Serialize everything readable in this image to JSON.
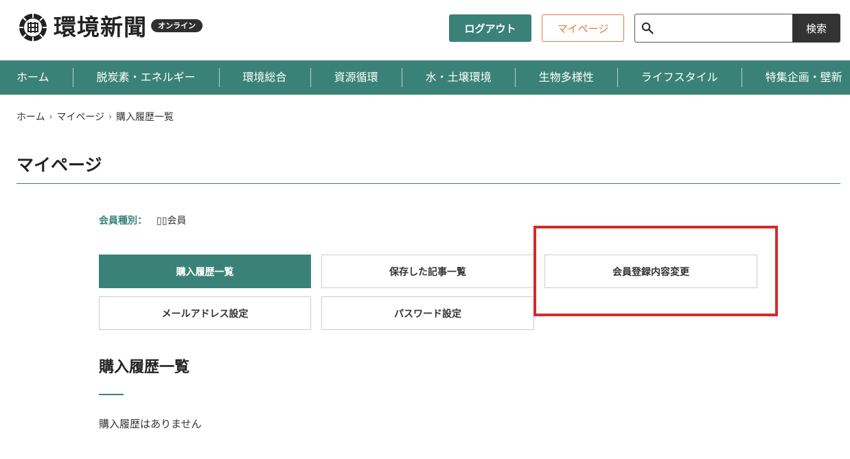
{
  "header": {
    "logo_text": "環境新聞",
    "logo_badge": "オンライン",
    "logout_label": "ログアウト",
    "mypage_label": "マイページ",
    "search": {
      "placeholder": "",
      "value": "",
      "button_label": "検索"
    }
  },
  "nav": {
    "items": [
      "ホーム",
      "脱炭素・エネルギー",
      "環境総合",
      "資源循環",
      "水・土壌環境",
      "生物多様性",
      "ライフスタイル",
      "特集企画・壁新"
    ]
  },
  "breadcrumb": {
    "items": [
      "ホーム",
      "マイページ",
      "購入履歴一覧"
    ],
    "separator": "›"
  },
  "page": {
    "title": "マイページ",
    "member_label": "会員種別：",
    "member_value": "▯▯会員"
  },
  "menu": {
    "purchase_history": "購入履歴一覧",
    "saved_articles": "保存した記事一覧",
    "edit_registration": "会員登録内容変更",
    "email_settings": "メールアドレス設定",
    "password_settings": "パスワード設定"
  },
  "section": {
    "title": "購入履歴一覧",
    "empty_message": "購入履歴はありません"
  },
  "colors": {
    "accent": "#3a8277",
    "mypage_orange": "#e27a3f",
    "highlight_red": "#d62a2a"
  }
}
